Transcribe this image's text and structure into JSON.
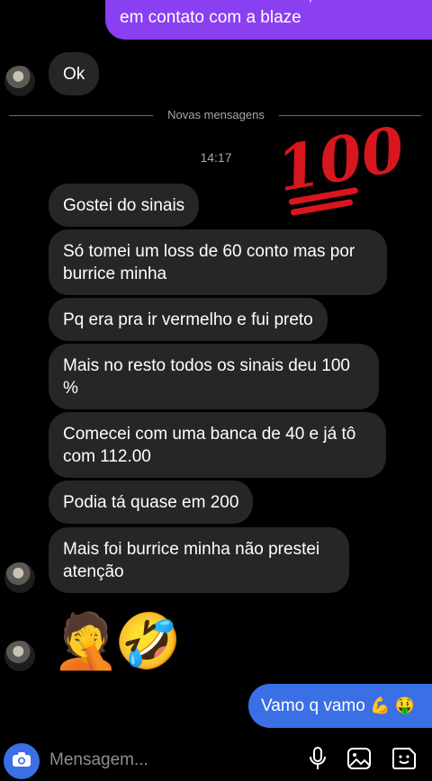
{
  "messages": [
    {
      "text": "Nao sabemos sobre isso, tente entrar em contato com a blaze"
    },
    {
      "text": "Ok"
    },
    {
      "text": "Gostei do sinais"
    },
    {
      "text": "Só tomei um loss de 60 conto mas por burrice minha"
    },
    {
      "text": "Pq era pra ir vermelho e fui preto"
    },
    {
      "text": "Mais no resto todos os sinais deu 100 %"
    },
    {
      "text": "Comecei com uma banca de 40 e já tô com 112.00"
    },
    {
      "text": "Podia tá quase em 200"
    },
    {
      "text": "Mais foi burrice minha não prestei atenção"
    },
    {
      "text": "Vamo q vamo"
    }
  ],
  "divider_label": "Novas mensagens",
  "timestamp": "14:17",
  "reaction_sticker": "100",
  "emojis": {
    "facepalm": "🤦",
    "rofl": "🤣",
    "muscle": "💪",
    "money_face": "🤑"
  },
  "composer": {
    "placeholder": "Mensagem..."
  },
  "colors": {
    "incoming": "#262626",
    "outgoing_purple": "#8a3ff0",
    "outgoing_blue": "#3a6fe6",
    "stamp": "#d8161e"
  }
}
